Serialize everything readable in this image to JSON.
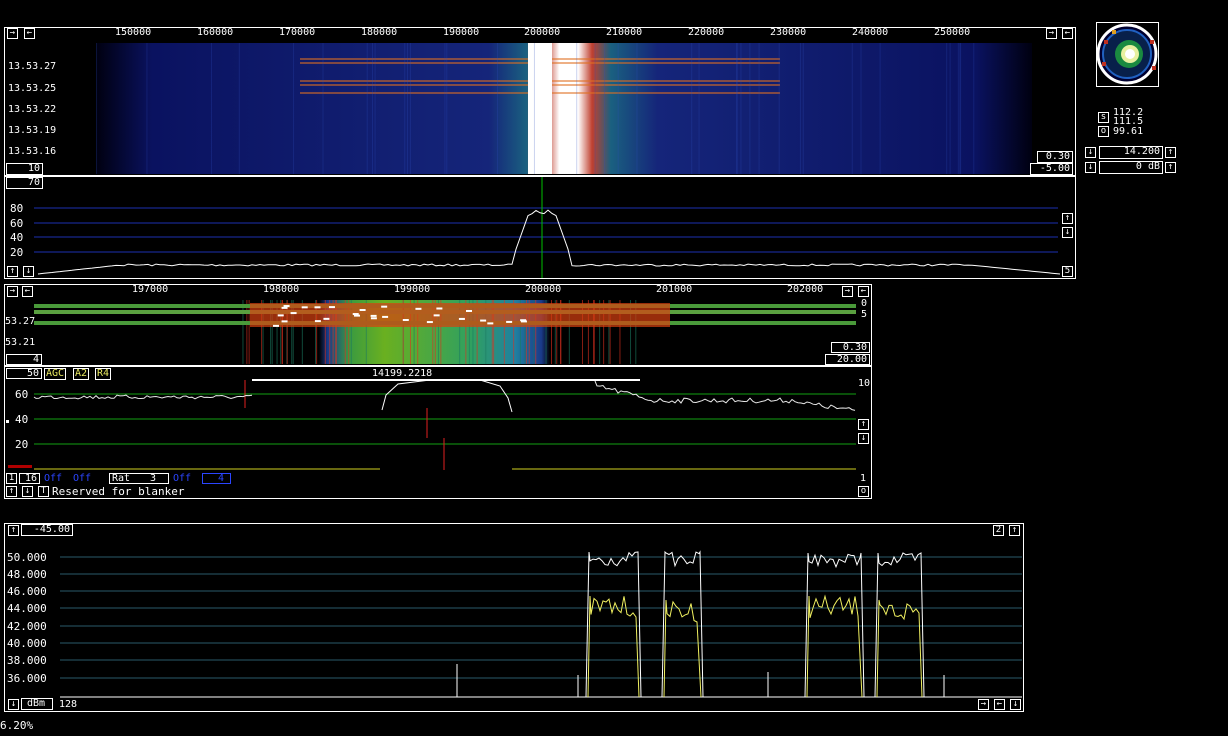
{
  "wide_waterfall": {
    "freq_ticks": [
      "150000",
      "160000",
      "170000",
      "180000",
      "190000",
      "200000",
      "210000",
      "220000",
      "230000",
      "240000",
      "250000"
    ],
    "times": [
      "13.53.27",
      "13.53.25",
      "13.53.22",
      "13.53.19",
      "13.53.16"
    ],
    "left_box": "10",
    "right_box_top": "0.30",
    "right_box_bottom": "-5.00"
  },
  "wide_spectrum": {
    "top_box": "70",
    "y_labels": [
      "80",
      "60",
      "40",
      "20"
    ],
    "right_box": "5"
  },
  "meter": {
    "s_label": "s",
    "o_label": "o",
    "values": [
      "112.2",
      "111.5",
      "99.61"
    ]
  },
  "freq_control": {
    "value": "14.200",
    "gain": "0 dB"
  },
  "narrow_waterfall": {
    "freq_ticks": [
      "197000",
      "198000",
      "199000",
      "200000",
      "201000",
      "202000"
    ],
    "times": [
      "53.27",
      "53.21"
    ],
    "left_box": "4",
    "right_top_a": "0",
    "right_top_b": "5",
    "right_box_top": "0.30",
    "right_box_bottom": "20.00"
  },
  "narrow_spectrum": {
    "top_box": "50",
    "modes": [
      "AGC",
      "A2",
      "R4"
    ],
    "frequency": "14199.2218",
    "y_labels": [
      "60",
      "40",
      "20"
    ],
    "right_top": "10",
    "right_bottom": "1",
    "o_label": "o"
  },
  "controls": {
    "box1": "1",
    "box16": "16",
    "off1": "Off",
    "off2": "Off",
    "rat_label": "Rat",
    "rat_value": "3",
    "off3": "Off",
    "val4": "4",
    "t_label": "T",
    "status": "Reserved for blanker"
  },
  "graph": {
    "top_value": "-45.00",
    "y_labels": [
      "50.000",
      "48.000",
      "46.000",
      "44.000",
      "42.000",
      "40.000",
      "38.000",
      "36.000"
    ],
    "right_num": "2",
    "unit": "dBm",
    "bottom_value": "128"
  },
  "cpu": "6.20%"
}
